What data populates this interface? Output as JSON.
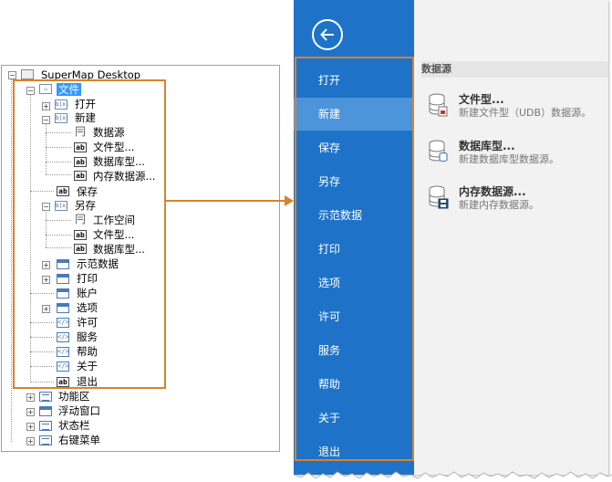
{
  "tree": {
    "root": "SuperMap Desktop",
    "file": "文件",
    "open": "打开",
    "new": "新建",
    "new_children": [
      "数据源",
      "文件型...",
      "数据库型...",
      "内存数据源..."
    ],
    "save": "保存",
    "save_as": "另存",
    "save_as_children": [
      "工作空间",
      "文件型...",
      "数据库型..."
    ],
    "sample_data": "示范数据",
    "print": "打印",
    "account": "账户",
    "options": "选项",
    "license": "许可",
    "service": "服务",
    "help": "帮助",
    "about": "关于",
    "exit": "退出",
    "ribbon": "功能区",
    "floating_window": "浮动窗口",
    "status_bar": "状态栏",
    "context_menu": "右键菜单"
  },
  "backstage": {
    "menu": [
      "打开",
      "新建",
      "保存",
      "另存",
      "示范数据",
      "打印",
      "选项",
      "许可",
      "服务",
      "帮助",
      "关于",
      "退出"
    ],
    "active_index": 1,
    "section_title": "数据源",
    "options": [
      {
        "title": "文件型...",
        "desc": "新建文件型（UDB）数据源。"
      },
      {
        "title": "数据库型...",
        "desc": "新建数据库型数据源。"
      },
      {
        "title": "内存数据源...",
        "desc": "新建内存数据源。"
      }
    ]
  },
  "colors": {
    "rail": "#1e73c8",
    "rail_active": "#4c95db",
    "highlight": "#d9822b",
    "selection": "#3399ff"
  }
}
